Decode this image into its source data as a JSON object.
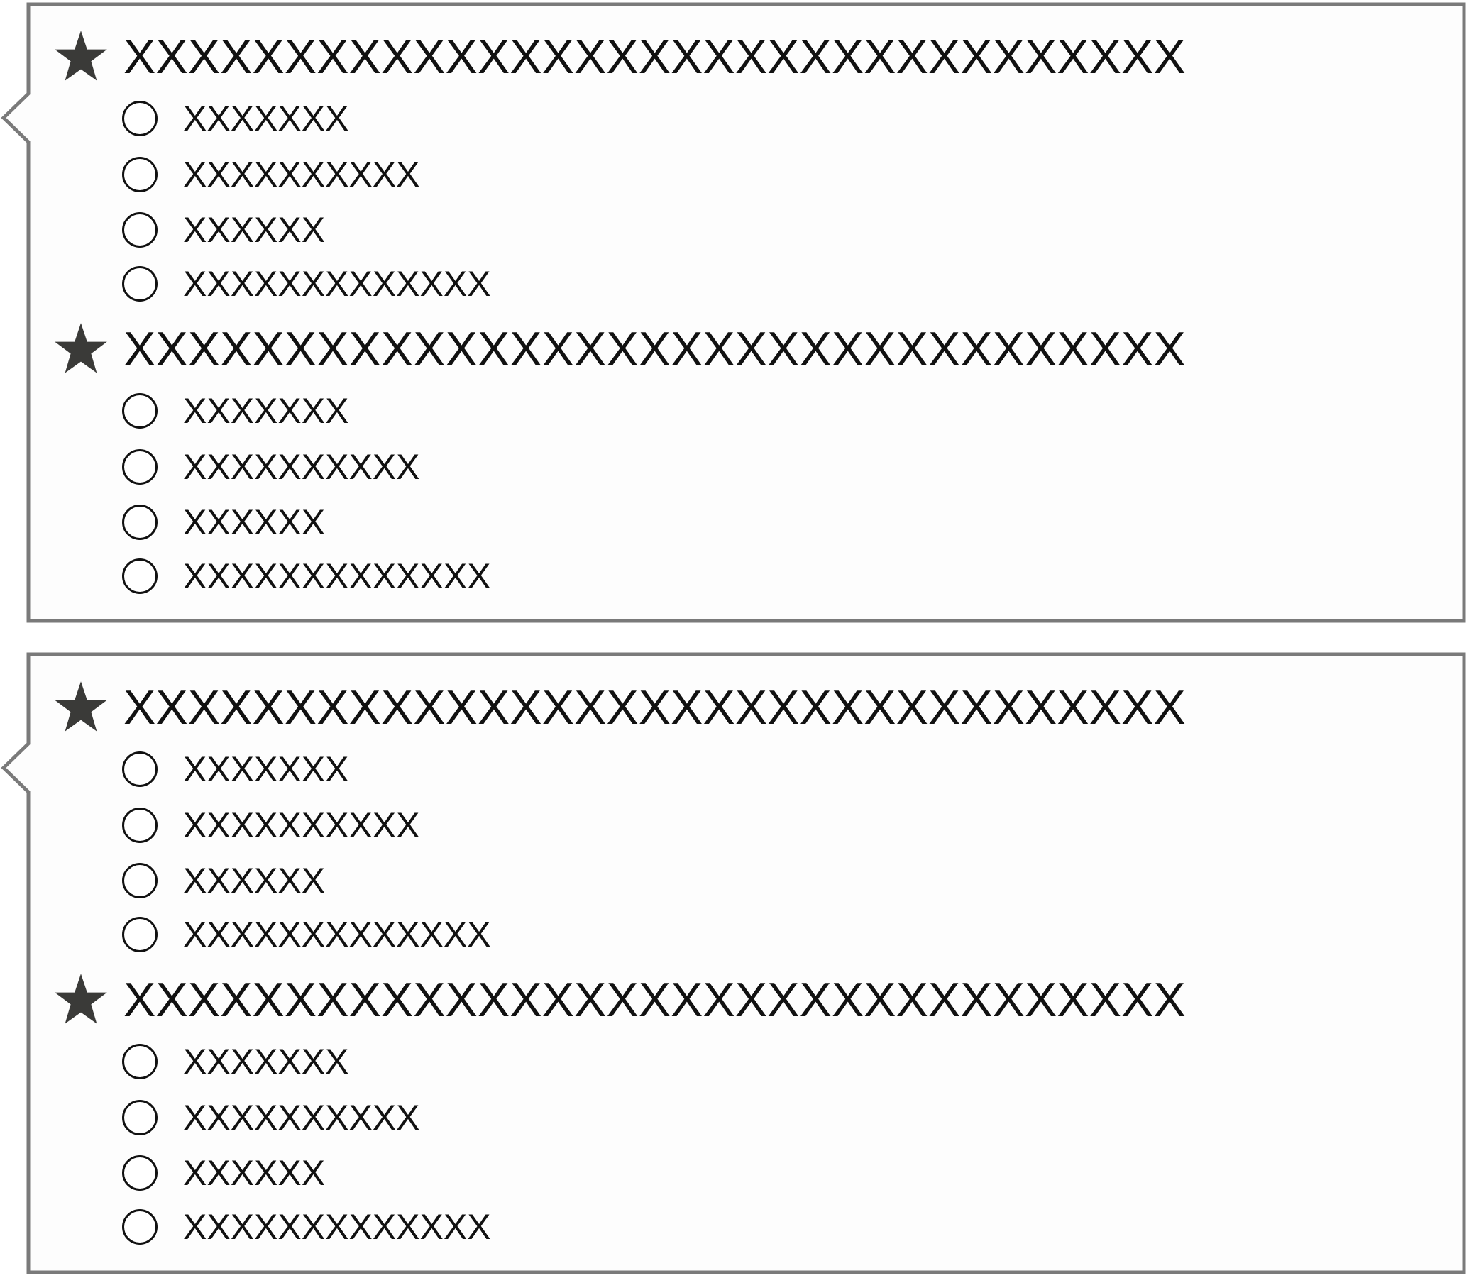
{
  "colors": {
    "outline": "#7a7a7a",
    "panel_background": "#fdfdfd",
    "star": "#3a3a38",
    "text": "#111111"
  },
  "icons": {
    "group_marker": "star-icon",
    "option_marker": "radio-circle-icon"
  },
  "panels": [
    {
      "groups": [
        {
          "title": "XXXXXXXXXXXXXXXXXXXXXXXXXXXXXXXXX",
          "options": [
            "XXXXXXX",
            "XXXXXXXXXX",
            "XXXXXX",
            "XXXXXXXXXXXXX"
          ]
        },
        {
          "title": "XXXXXXXXXXXXXXXXXXXXXXXXXXXXXXXXX",
          "options": [
            "XXXXXXX",
            "XXXXXXXXXX",
            "XXXXXX",
            "XXXXXXXXXXXXX"
          ]
        }
      ]
    },
    {
      "groups": [
        {
          "title": "XXXXXXXXXXXXXXXXXXXXXXXXXXXXXXXXX",
          "options": [
            "XXXXXXX",
            "XXXXXXXXXX",
            "XXXXXX",
            "XXXXXXXXXXXXX"
          ]
        },
        {
          "title": "XXXXXXXXXXXXXXXXXXXXXXXXXXXXXXXXX",
          "options": [
            "XXXXXXX",
            "XXXXXXXXXX",
            "XXXXXX",
            "XXXXXXXXXXXXX"
          ]
        }
      ]
    }
  ]
}
